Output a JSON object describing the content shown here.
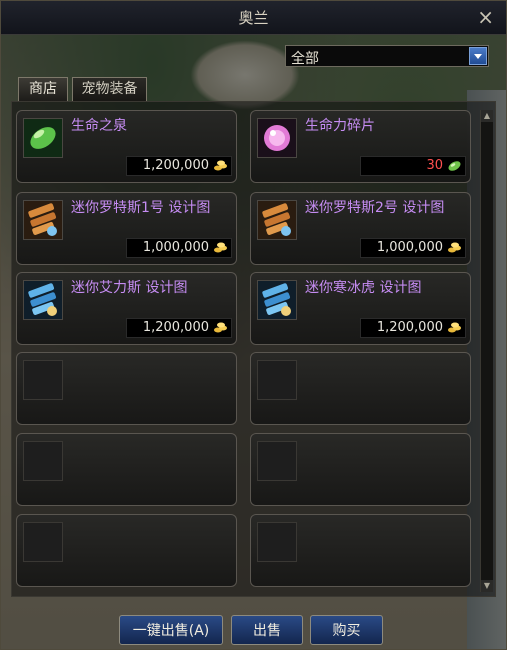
{
  "window": {
    "title": "奥兰",
    "close": "×"
  },
  "filter": {
    "value": "全部"
  },
  "tabs": [
    {
      "label": "商店",
      "active": true
    },
    {
      "label": "宠物装备",
      "active": false
    }
  ],
  "items": [
    {
      "name": "生命之泉",
      "price": "1,200,000",
      "currency": "gold",
      "icon": "green-gem-icon"
    },
    {
      "name": "生命力碎片",
      "price": "30",
      "currency": "green-crystal",
      "icon": "pink-orb-icon",
      "price_color": "#ff5050"
    },
    {
      "name": "迷你罗特斯1号  设计图",
      "price": "1,000,000",
      "currency": "gold",
      "icon": "blueprint-scroll-orange-icon"
    },
    {
      "name": "迷你罗特斯2号  设计图",
      "price": "1,000,000",
      "currency": "gold",
      "icon": "blueprint-scroll-orange-icon"
    },
    {
      "name": "迷你艾力斯  设计图",
      "price": "1,200,000",
      "currency": "gold",
      "icon": "blueprint-scroll-blue-icon"
    },
    {
      "name": "迷你寒冰虎  设计图",
      "price": "1,200,000",
      "currency": "gold",
      "icon": "blueprint-scroll-blue-icon"
    }
  ],
  "empty_slots": 6,
  "actions": {
    "sell_all": "一键出售(A)",
    "sell": "出售",
    "buy": "购买"
  }
}
